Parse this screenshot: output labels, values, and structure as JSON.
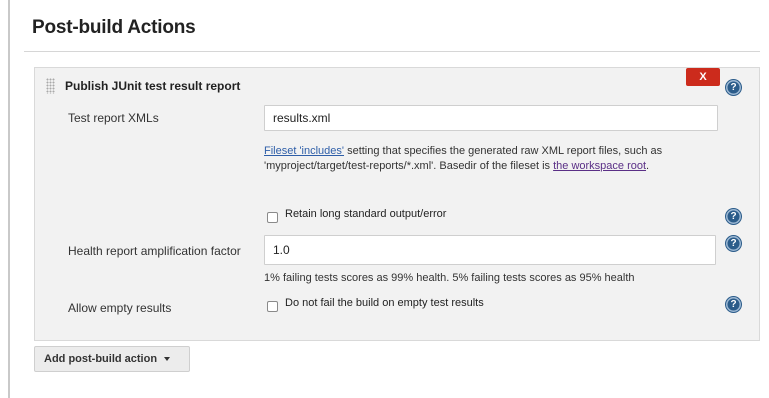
{
  "section": {
    "title": "Post-build Actions"
  },
  "panel": {
    "title": "Publish JUnit test result report",
    "delete_label": "X",
    "help_glyph": "?"
  },
  "fields": {
    "test_report_xmls": {
      "label": "Test report XMLs",
      "value": "results.xml"
    },
    "description": {
      "link1": "Fileset 'includes'",
      "text1": " setting that specifies the generated raw XML report files, such as 'myproject/target/test-reports/*.xml'. Basedir of the fileset is ",
      "link2": "the workspace root",
      "text2": "."
    },
    "retain_output": {
      "label": "Retain long standard output/error",
      "checked": false
    },
    "health_factor": {
      "label": "Health report amplification factor",
      "value": "1.0",
      "description": "1% failing tests scores as 99% health. 5% failing tests scores as 95% health"
    },
    "allow_empty": {
      "label": "Allow empty results",
      "checkbox_label": "Do not fail the build on empty test results",
      "checked": false
    }
  },
  "footer": {
    "add_action_label": "Add post-build action"
  },
  "colors": {
    "delete_button": "#cc2b1c",
    "help_icon": "#2b5c8a",
    "link": "#2e5ea8",
    "visited_link": "#5a2f86",
    "panel_bg": "#f2f2f2"
  }
}
